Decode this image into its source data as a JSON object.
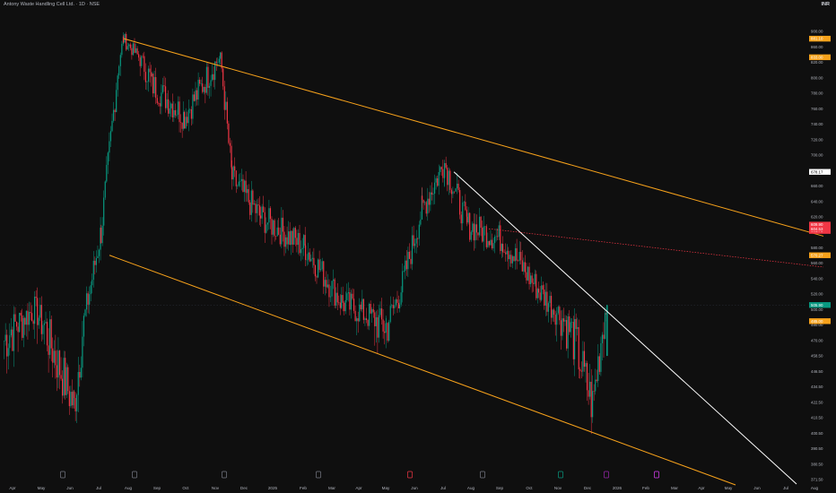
{
  "header": {
    "title": "Antony Waste Handling Cell Ltd. · 1D · NSE",
    "unit": "INR"
  },
  "chart_data": {
    "type": "candlestick",
    "x_ticks": [
      "Apr",
      "May",
      "Jun",
      "Jul",
      "Aug",
      "Sep",
      "Oct",
      "Nov",
      "Dec",
      "2025",
      "Feb",
      "Mar",
      "Apr",
      "May",
      "Jun",
      "Jul",
      "Aug",
      "Sep",
      "Oct",
      "Nov",
      "Dec",
      "2026",
      "Feb",
      "Mar",
      "Apr",
      "May",
      "Jun",
      "Jul",
      "Aug"
    ],
    "y_ticks": [
      900.0,
      860.0,
      820.0,
      800.0,
      780.0,
      760.0,
      740.0,
      720.0,
      700.0,
      680.0,
      660.0,
      640.0,
      620.0,
      600.0,
      580.0,
      560.0,
      540.0,
      520.0,
      500.0,
      480.0,
      470.0,
      458.5,
      446.5,
      434.5,
      422.5,
      410.5,
      400.5,
      390.5,
      380.5,
      371.5
    ],
    "ylim": [
      366,
      906
    ],
    "price_tags": [
      {
        "label": "881.10",
        "value": 881.1,
        "color": "#f7a21b"
      },
      {
        "label": "833.00",
        "value": 833.0,
        "color": "#f7a21b"
      },
      {
        "label": "678.17",
        "value": 678.17,
        "color": "#ffffff"
      },
      {
        "label": "609.90",
        "value": 609.9,
        "color": "#f23645"
      },
      {
        "label": "601.75",
        "value": 601.75,
        "color": "#f23645"
      },
      {
        "label": "604.53",
        "value": 604.53,
        "color": "#f23645"
      },
      {
        "label": "570.27",
        "value": 570.27,
        "color": "#f7a21b"
      },
      {
        "label": "505.90",
        "value": 505.9,
        "color": "#089981"
      },
      {
        "label": "485.00",
        "value": 485.0,
        "color": "#f7a21b"
      }
    ],
    "last_price": 505.9,
    "series": [
      {
        "name": "",
        "points": [
          [
            "Apr 2024",
            470
          ],
          [
            "May 2024",
            500
          ],
          [
            "Jun 2024",
            420
          ],
          [
            "Jul 2024",
            600
          ],
          [
            "Aug 2024",
            880
          ],
          [
            "Sep 2024",
            790
          ],
          [
            "Oct 2024",
            750
          ],
          [
            "Nov 2024",
            830
          ],
          [
            "Dec 2024",
            670
          ],
          [
            "2025",
            620
          ],
          [
            "Feb 2025",
            580
          ],
          [
            "Mar 2025",
            510
          ],
          [
            "Apr 2025",
            480
          ],
          [
            "May 2025",
            520
          ],
          [
            "Jun 2025",
            630
          ],
          [
            "Jul 2025",
            690
          ],
          [
            "Aug 2025",
            610
          ],
          [
            "Sep 2025",
            590
          ],
          [
            "Oct 2025",
            525
          ],
          [
            "Nov 2025",
            470
          ],
          [
            "Dec 2025",
            420
          ],
          [
            "Dec 2025 (last)",
            505.9
          ]
        ]
      }
    ]
  }
}
